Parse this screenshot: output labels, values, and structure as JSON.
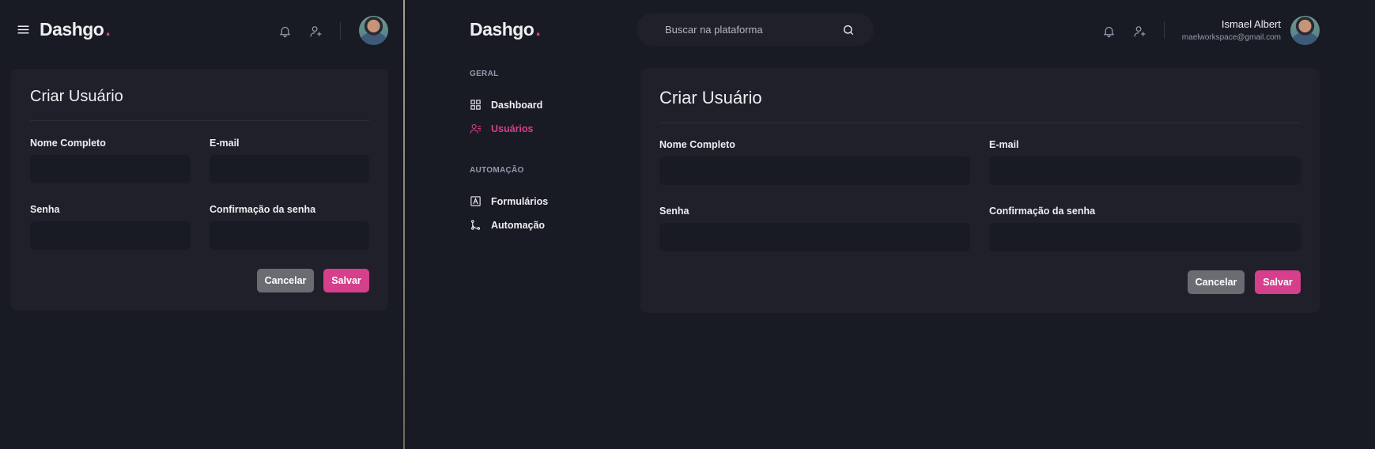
{
  "brand": {
    "name": "Dashgo",
    "dot": ".",
    "accent_color": "#d53f8c"
  },
  "header": {
    "search_placeholder": "Buscar na plataforma",
    "user": {
      "name": "Ismael Albert",
      "email": "maelworkspace@gmail.com"
    },
    "icons": [
      "menu-icon",
      "bell-icon",
      "user-plus-icon",
      "search-icon"
    ]
  },
  "sidebar": {
    "sections": [
      {
        "title": "GERAL",
        "items": [
          {
            "label": "Dashboard",
            "icon": "dashboard-icon",
            "active": false
          },
          {
            "label": "Usuários",
            "icon": "users-icon",
            "active": true
          }
        ]
      },
      {
        "title": "AUTOMAÇÃO",
        "items": [
          {
            "label": "Formulários",
            "icon": "form-icon",
            "active": false
          },
          {
            "label": "Automação",
            "icon": "git-branch-icon",
            "active": false
          }
        ]
      }
    ]
  },
  "form": {
    "title": "Criar Usuário",
    "fields": {
      "full_name": {
        "label": "Nome Completo",
        "value": ""
      },
      "email": {
        "label": "E-mail",
        "value": ""
      },
      "password": {
        "label": "Senha",
        "value": ""
      },
      "password_confirmation": {
        "label": "Confirmação da senha",
        "value": ""
      }
    },
    "cancel_label": "Cancelar",
    "save_label": "Salvar"
  }
}
